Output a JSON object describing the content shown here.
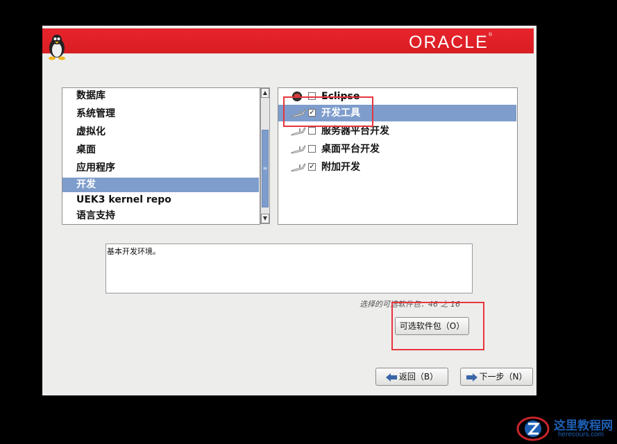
{
  "header": {
    "logo_text": "ORACLE",
    "logo_mark": "®"
  },
  "categories": {
    "items": [
      {
        "label": "数据库"
      },
      {
        "label": "系统管理"
      },
      {
        "label": "虚拟化"
      },
      {
        "label": "桌面"
      },
      {
        "label": "应用程序"
      },
      {
        "label": "开发",
        "selected": true
      },
      {
        "label": "UEK3 kernel repo"
      },
      {
        "label": "语言支持"
      }
    ]
  },
  "groups": {
    "items": [
      {
        "label": "Eclipse",
        "checked": false,
        "icon": "globe-icon"
      },
      {
        "label": "开发工具",
        "checked": true,
        "selected": true,
        "icon": "tools-icon"
      },
      {
        "label": "服务器平台开发",
        "checked": false,
        "icon": "tools-icon"
      },
      {
        "label": "桌面平台开发",
        "checked": false,
        "icon": "tools-icon"
      },
      {
        "label": "附加开发",
        "checked": true,
        "icon": "tools-icon"
      }
    ]
  },
  "description": "基本开发环境。",
  "package_count": "选择的可选软件包：46 之 16",
  "buttons": {
    "optional_packages": "可选软件包（O）",
    "back": "返回（B）",
    "next": "下一步（N）"
  },
  "watermark": {
    "title": "这里教程网",
    "url": "herecours.com"
  },
  "colors": {
    "banner": "#e0222a",
    "selection": "#7e9dcc",
    "highlight": "#e8343c"
  }
}
